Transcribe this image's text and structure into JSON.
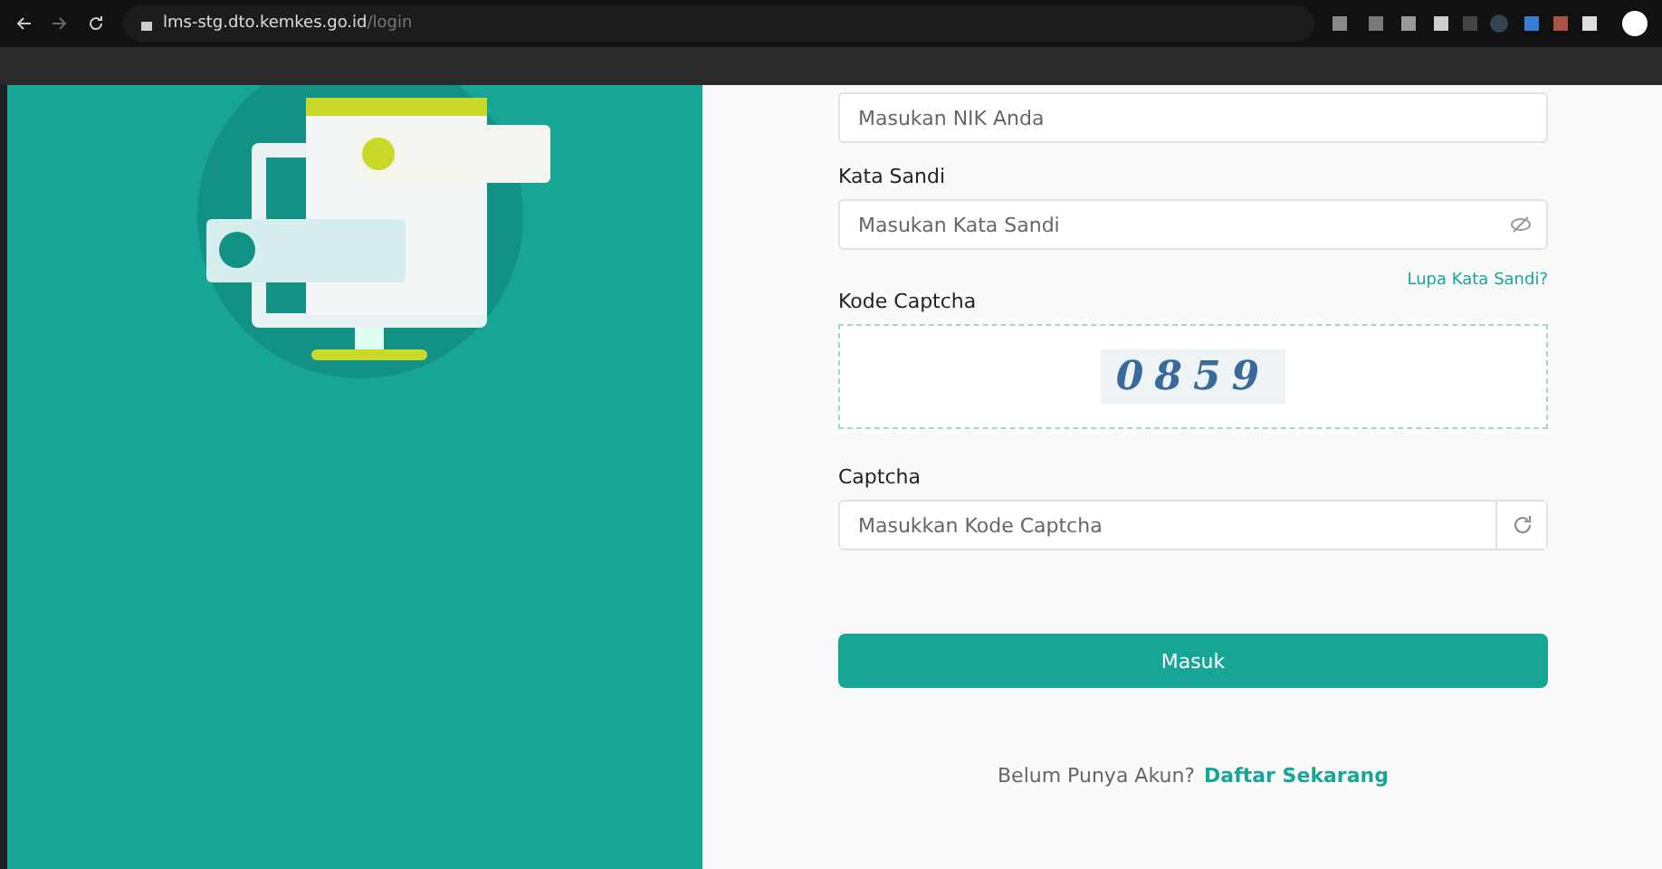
{
  "browser": {
    "url_host": "lms-stg.dto.kemkes.go.id",
    "url_path": "/login"
  },
  "form": {
    "nik_placeholder": "Masukan NIK Anda",
    "password_label": "Kata Sandi",
    "password_placeholder": "Masukan Kata Sandi",
    "forgot_link": "Lupa Kata Sandi?",
    "captcha_label": "Kode Captcha",
    "captcha_code": "0859",
    "captcha_input_label": "Captcha",
    "captcha_placeholder": "Masukkan Kode Captcha",
    "submit": "Masuk",
    "register_prompt": "Belum Punya Akun?",
    "register_link": "Daftar Sekarang"
  }
}
